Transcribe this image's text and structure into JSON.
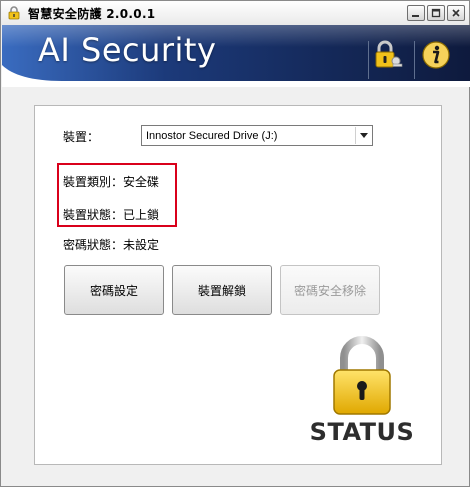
{
  "window": {
    "title": "智慧安全防護 2.0.0.1",
    "controls": [
      "minimize-icon",
      "maximize-icon",
      "close-icon"
    ]
  },
  "banner": {
    "title": "AI Security",
    "buttons": [
      "lock-key-icon",
      "info-icon"
    ]
  },
  "device": {
    "label": "裝置：",
    "selected": "Innostor Secured Drive (J:)"
  },
  "info": {
    "device_type": "裝置類別：安全碟",
    "device_state": "裝置狀態：已上鎖",
    "password_state": "密碼狀態：未設定"
  },
  "buttons": {
    "set_password": "密碼設定",
    "unlock_device": "裝置解鎖",
    "remove_password": "密碼安全移除"
  },
  "status": {
    "label": "STATUS",
    "icon": "padlock-icon"
  },
  "colors": {
    "banner_dark": "#0e1a3d",
    "banner_blue": "#2f5ea8",
    "highlight_red": "#d9001b",
    "padlock_gold": "#f1c21b"
  }
}
